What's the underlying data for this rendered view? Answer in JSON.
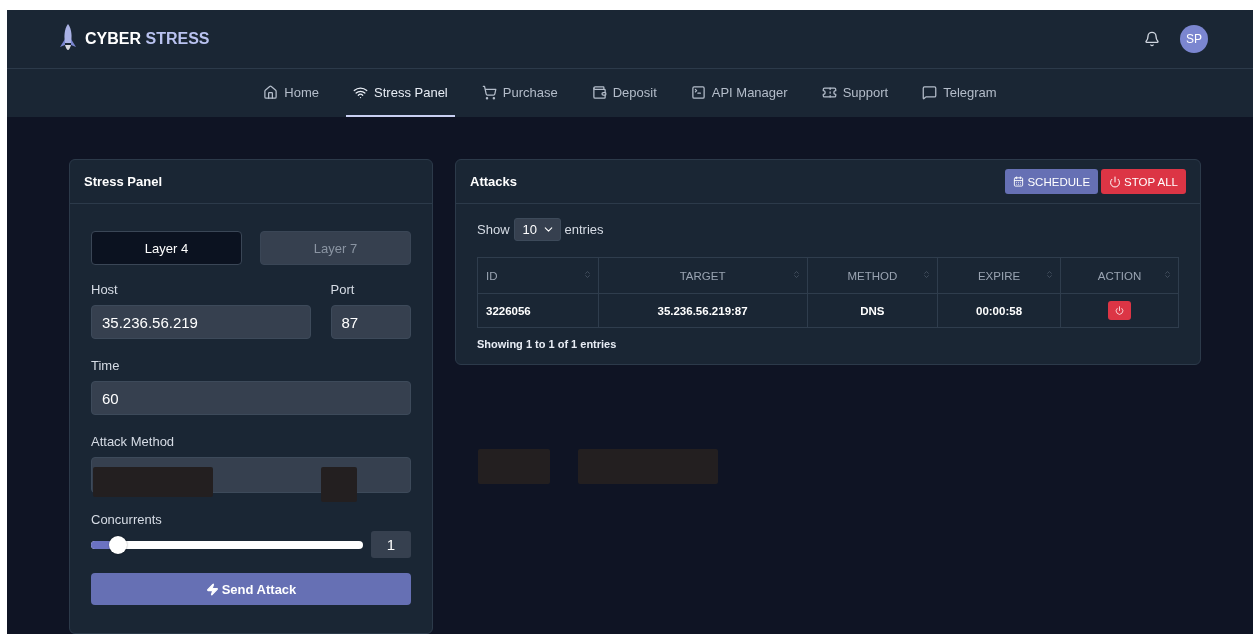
{
  "brand": {
    "word_1": "CYBER",
    "word_2": "STRESS"
  },
  "user": {
    "initials": "SP"
  },
  "nav": [
    {
      "label": "Home",
      "selected": false
    },
    {
      "label": "Stress Panel",
      "selected": true
    },
    {
      "label": "Purchase",
      "selected": false
    },
    {
      "label": "Deposit",
      "selected": false
    },
    {
      "label": "API Manager",
      "selected": false
    },
    {
      "label": "Support",
      "selected": false
    },
    {
      "label": "Telegram",
      "selected": false
    }
  ],
  "stress_panel": {
    "title": "Stress Panel",
    "layers": [
      {
        "label": "Layer 4",
        "selected": true
      },
      {
        "label": "Layer 7",
        "selected": false
      }
    ],
    "host": {
      "label": "Host",
      "value": "35.236.56.219"
    },
    "port": {
      "label": "Port",
      "value": "87"
    },
    "time": {
      "label": "Time",
      "value": "60"
    },
    "method": {
      "label": "Attack Method"
    },
    "concurrents": {
      "label": "Concurrents",
      "level": 0.1,
      "value": "1"
    },
    "submit": "Send Attack"
  },
  "attacks": {
    "title": "Attacks",
    "schedule": "SCHEDULE",
    "stop_all": "STOP ALL",
    "show": "Show",
    "page_size": "10",
    "entries": "entries",
    "columns": [
      "ID",
      "TARGET",
      "METHOD",
      "EXPIRE",
      "ACTION"
    ],
    "rows": [
      {
        "id": "3226056",
        "target": "35.236.56.219:87",
        "method": "DNS",
        "expire": "00:00:58"
      }
    ],
    "footer": "Showing 1 to 1 of 1 entries"
  }
}
